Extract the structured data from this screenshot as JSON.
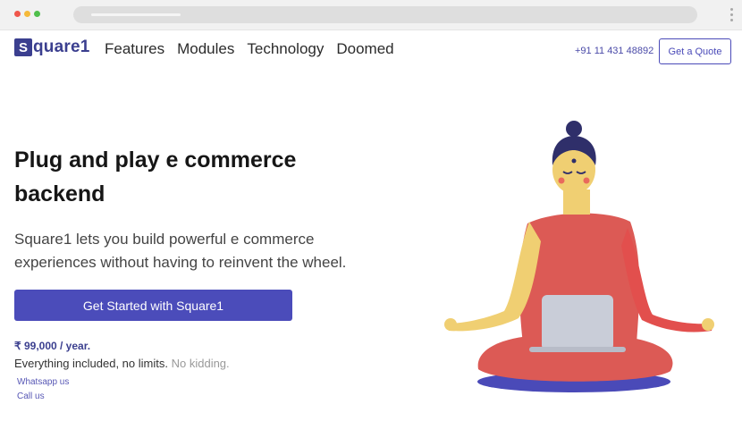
{
  "browser": {
    "address": ""
  },
  "nav": {
    "logo_mark": "S",
    "logo_text": "quare1",
    "items": [
      "Features",
      "Modules",
      "Technology",
      "Doomed"
    ],
    "phone": "+91 11 431 48892",
    "quote_label": "Get a Quote"
  },
  "hero": {
    "title": "Plug and play e commerce backend",
    "subtitle": "Square1 lets you build powerful e commerce experiences without having to reinvent the wheel.",
    "cta_label": "Get Started with Square1",
    "price": "₹ 99,000 / year.",
    "included": "Everything included, no limits.",
    "kidding": "No kidding.",
    "link_whatsapp": "Whatsapp us",
    "link_call": "Call us"
  },
  "illustration": {
    "icon": "meditating-figure-with-laptop-illustration"
  },
  "colors": {
    "brand": "#3b3f8f",
    "accent": "#4b4cba",
    "robe": "#dc5a55",
    "skin": "#f0cf72",
    "laptop": "#c9cdd8"
  }
}
